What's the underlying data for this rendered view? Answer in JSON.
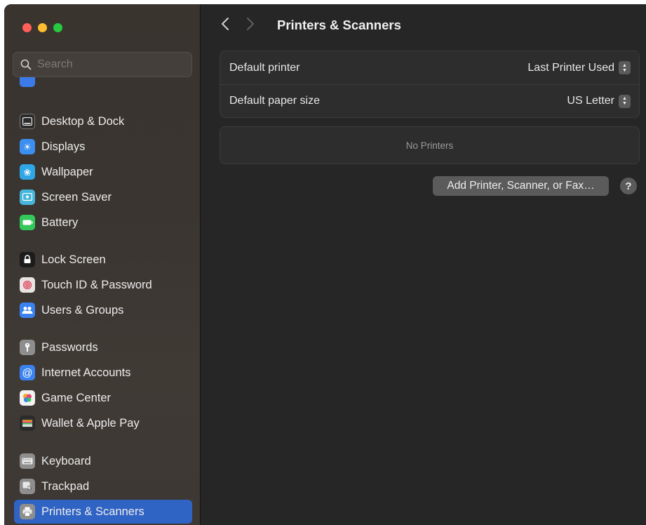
{
  "window": {
    "title": "Printers & Scanners"
  },
  "traffic_lights": {
    "close": "#ff5f57",
    "minimize": "#febc2e",
    "zoom": "#28c840"
  },
  "search": {
    "placeholder": "Search"
  },
  "sidebar": {
    "items": [
      {
        "label": "Desktop & Dock",
        "icon": "desktop-dock-icon",
        "color": "#2b2b2b"
      },
      {
        "label": "Displays",
        "icon": "sun-icon",
        "color": "#3b8ff0"
      },
      {
        "label": "Wallpaper",
        "icon": "flower-icon",
        "color": "#2fa6e6"
      },
      {
        "label": "Screen Saver",
        "icon": "screen-saver-icon",
        "color": "#45b6d9"
      },
      {
        "label": "Battery",
        "icon": "battery-icon",
        "color": "#34c759"
      },
      {
        "label": "Lock Screen",
        "icon": "lock-icon",
        "color": "#1c1c1c"
      },
      {
        "label": "Touch ID & Password",
        "icon": "fingerprint-icon",
        "color": "#e9e4e2"
      },
      {
        "label": "Users & Groups",
        "icon": "users-icon",
        "color": "#3a82f0"
      },
      {
        "label": "Passwords",
        "icon": "key-icon",
        "color": "#8e8e8e"
      },
      {
        "label": "Internet Accounts",
        "icon": "at-icon",
        "color": "#3a82f0"
      },
      {
        "label": "Game Center",
        "icon": "game-center-icon",
        "color": "#f2f2f2"
      },
      {
        "label": "Wallet & Apple Pay",
        "icon": "wallet-icon",
        "color": "#2b2b2b"
      },
      {
        "label": "Keyboard",
        "icon": "keyboard-icon",
        "color": "#8e8e8e"
      },
      {
        "label": "Trackpad",
        "icon": "trackpad-icon",
        "color": "#8e8e8e"
      },
      {
        "label": "Printers & Scanners",
        "icon": "printer-icon",
        "color": "#8e8e8e",
        "selected": true
      }
    ]
  },
  "main": {
    "title": "Printers & Scanners",
    "settings": [
      {
        "label": "Default printer",
        "value": "Last Printer Used"
      },
      {
        "label": "Default paper size",
        "value": "US Letter"
      }
    ],
    "printers_empty": "No Printers",
    "add_button": "Add Printer, Scanner, or Fax…",
    "help_button": "?"
  }
}
